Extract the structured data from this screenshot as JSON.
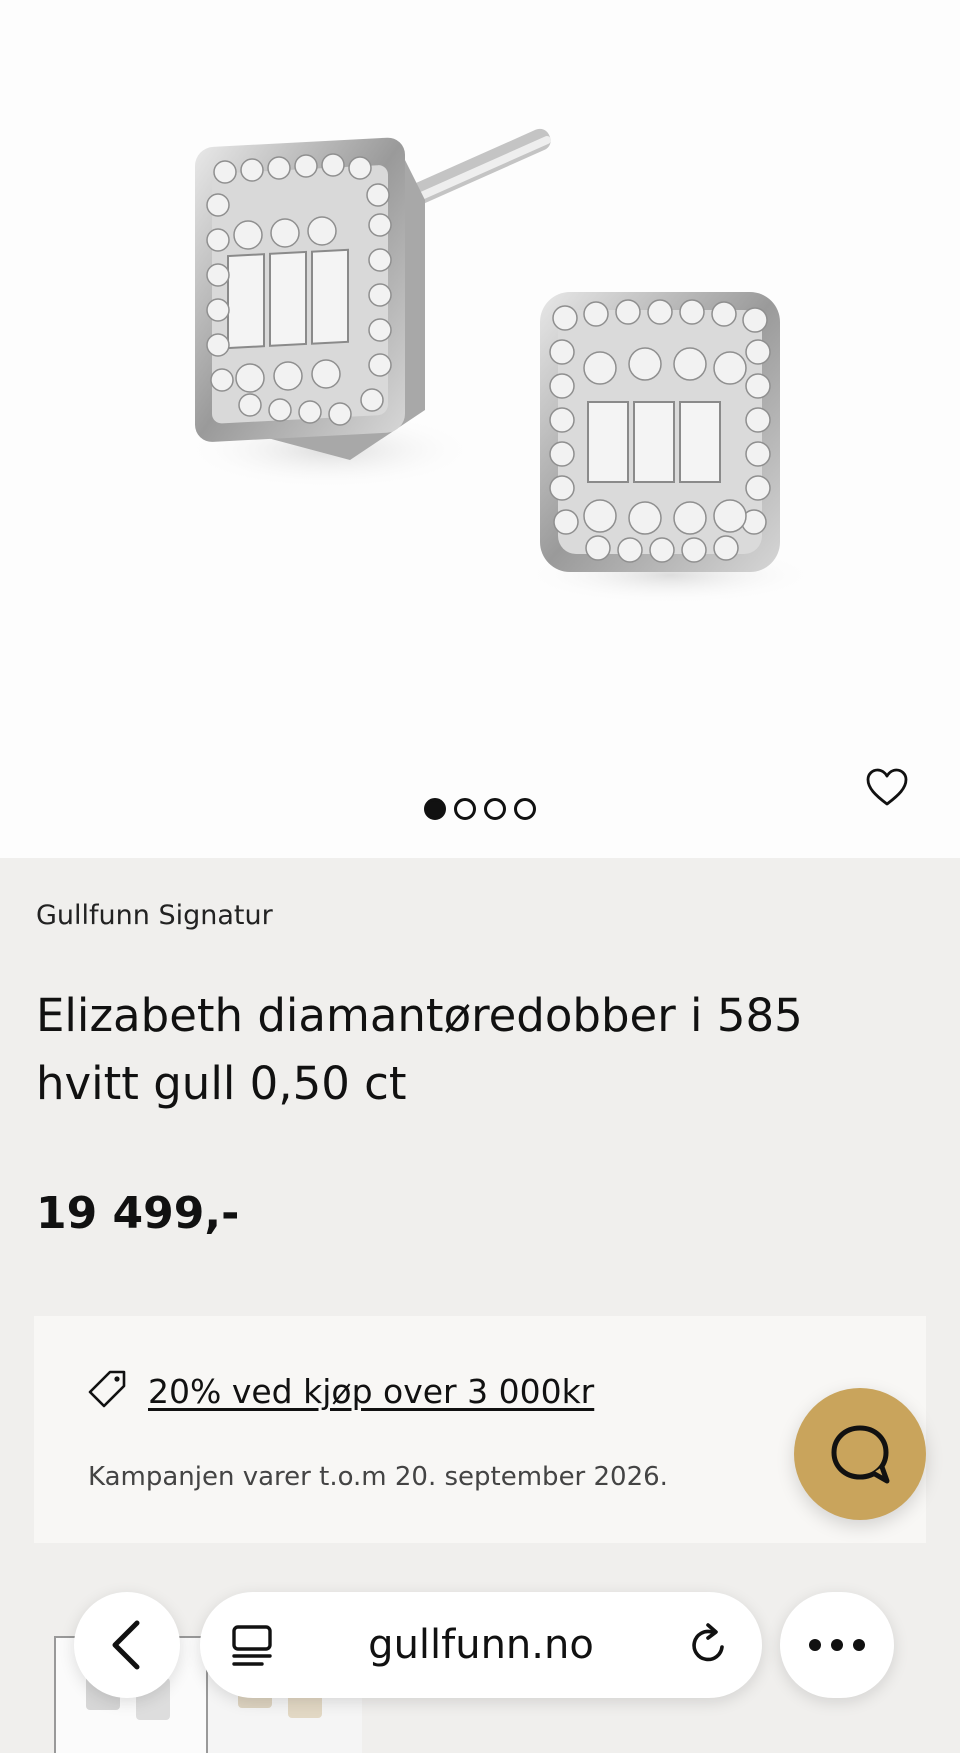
{
  "product": {
    "brand": "Gullfunn Signatur",
    "title": "Elizabeth diamantøredobber i 585 hvitt gull 0,50 ct",
    "price": "19 499,-",
    "image_count": 4,
    "active_image": 1
  },
  "promo": {
    "link_text": "20% ved kjøp over 3 000kr",
    "note": "Kampanjen varer t.o.m 20. september 2026.",
    "icon": "tag-icon"
  },
  "browser": {
    "url": "gullfunn.no",
    "icons": [
      "back-arrow-icon",
      "reader-icon",
      "reload-icon",
      "more-icon"
    ]
  },
  "colors": {
    "accent_chat": "#c9a45c",
    "page_bg": "#f0efed",
    "promo_bg": "#f8f7f5"
  }
}
